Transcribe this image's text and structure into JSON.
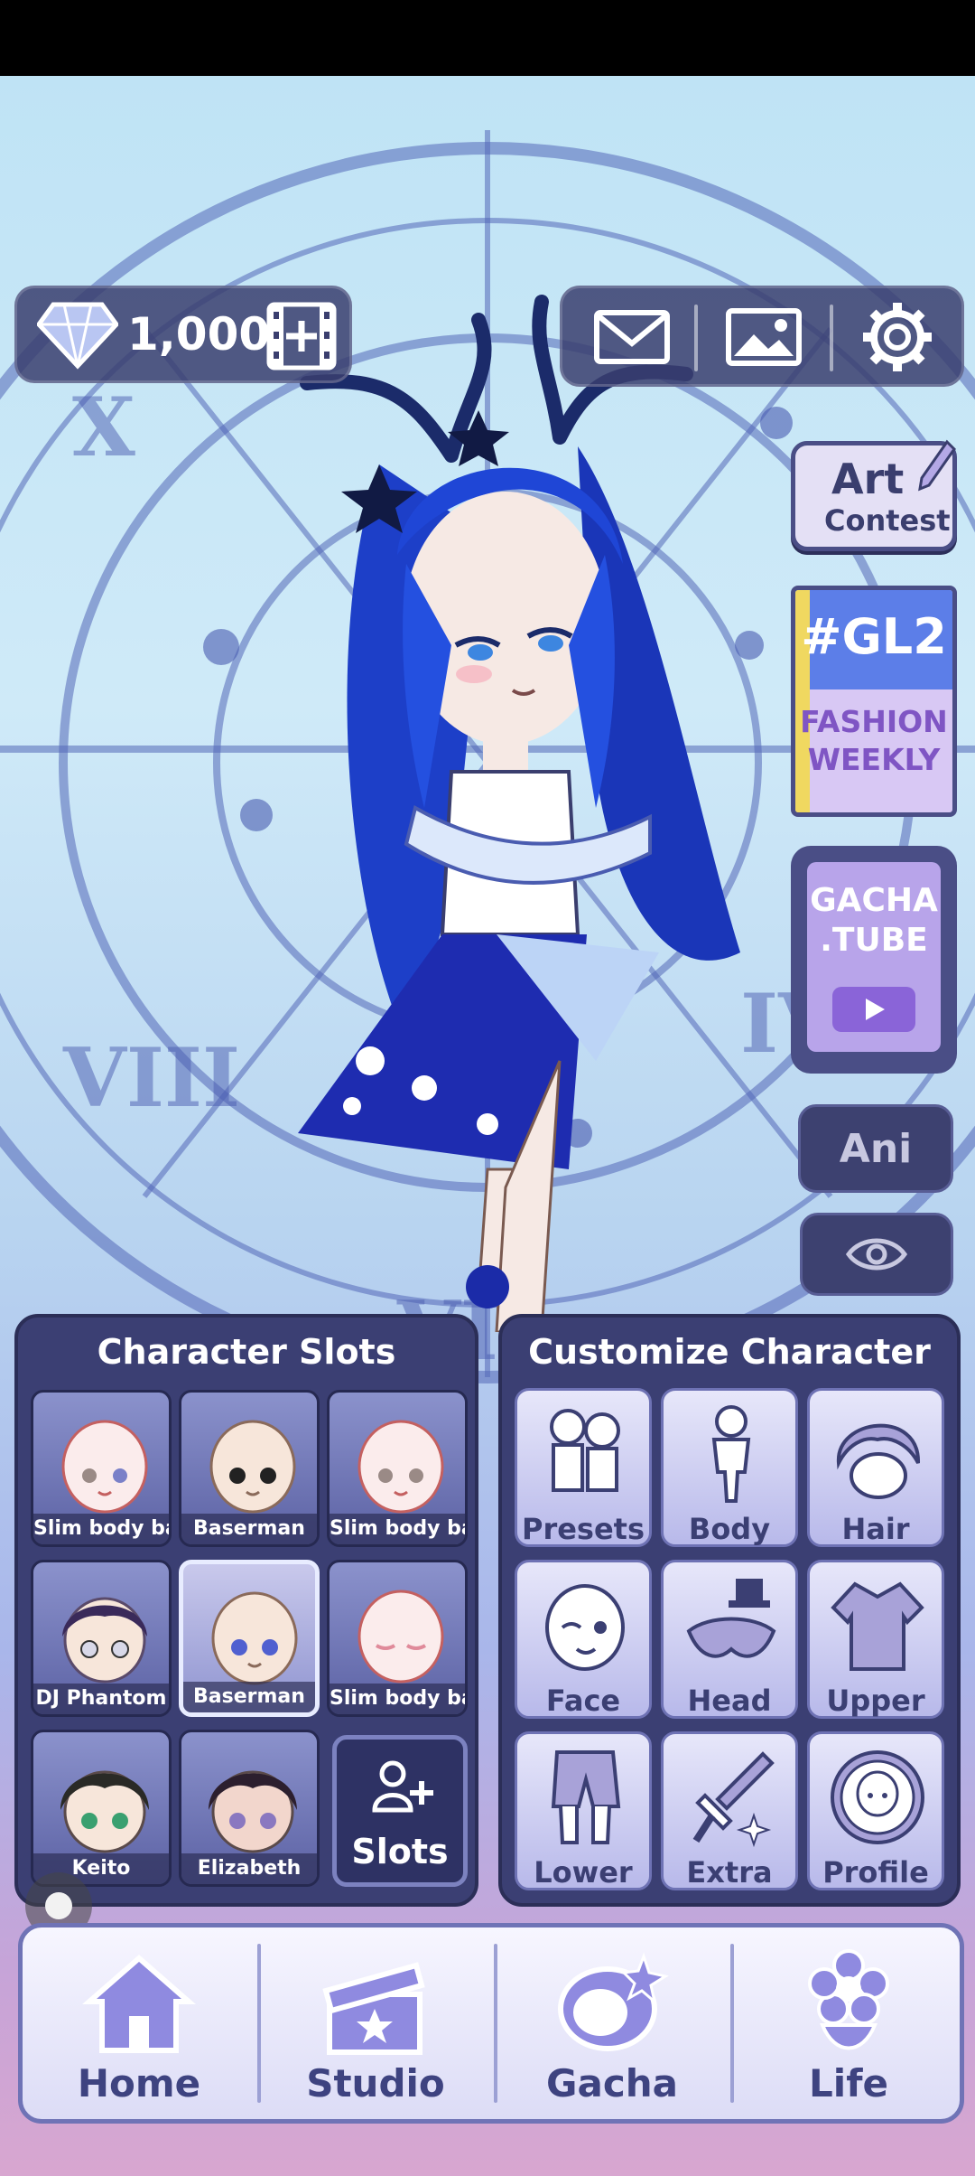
{
  "top_bar": {
    "currency_amount": "1,000"
  },
  "side_buttons": {
    "art_contest_line1": "Art",
    "art_contest_line2": "Contest",
    "fashion_tag": "#GL2",
    "fashion_line1": "FASHION",
    "fashion_line2": "WEEKLY",
    "gacha_tube_line1": "GACHA",
    "gacha_tube_line2": ".TUBE",
    "ani_label": "Ani"
  },
  "slots_panel": {
    "title": "Character Slots",
    "slots": [
      {
        "label": "Slim body bas"
      },
      {
        "label": "Baserman"
      },
      {
        "label": "Slim body bas"
      },
      {
        "label": "DJ Phantom"
      },
      {
        "label": "Baserman"
      },
      {
        "label": "Slim body bas"
      },
      {
        "label": "Keito"
      },
      {
        "label": "Elizabeth"
      }
    ],
    "add_slots_label": "Slots"
  },
  "customize_panel": {
    "title": "Customize Character",
    "items": [
      {
        "label": "Presets"
      },
      {
        "label": "Body"
      },
      {
        "label": "Hair"
      },
      {
        "label": "Face"
      },
      {
        "label": "Head"
      },
      {
        "label": "Upper"
      },
      {
        "label": "Lower"
      },
      {
        "label": "Extra"
      },
      {
        "label": "Profile"
      }
    ]
  },
  "bottom_nav": {
    "items": [
      {
        "label": "Home"
      },
      {
        "label": "Studio"
      },
      {
        "label": "Gacha"
      },
      {
        "label": "Life"
      }
    ]
  },
  "icons": {
    "currency": "diamond-icon",
    "add_currency": "film-plus-icon",
    "mail": "mail-icon",
    "gallery": "image-icon",
    "settings": "gear-icon",
    "visibility": "eye-icon",
    "add_slot": "add-user-icon",
    "home": "house-icon",
    "studio": "clapperboard-icon",
    "gacha": "coconut-icon",
    "life": "flower-icon"
  },
  "colors": {
    "panel_dark": "#3b3f73",
    "accent_blue": "#5c7ee8",
    "accent_purple": "#7f55c4",
    "nav_text": "#3e4380"
  }
}
